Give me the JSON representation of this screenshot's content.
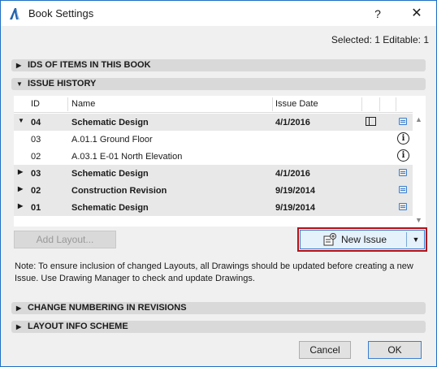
{
  "window": {
    "title": "Book Settings",
    "help_label": "?",
    "close_label": "✕",
    "border_color": "#1f6fc4"
  },
  "header": {
    "selection_info": "Selected: 1 Editable: 1"
  },
  "sections": {
    "ids": "IDS OF ITEMS IN THIS BOOK",
    "issue_history": "ISSUE HISTORY",
    "change_numbering": "CHANGE NUMBERING IN REVISIONS",
    "layout_info": "LAYOUT INFO SCHEME"
  },
  "table": {
    "columns": [
      "ID",
      "Name",
      "Issue Date"
    ],
    "rows": [
      {
        "id": "04",
        "name": "Schematic Design",
        "date": "4/1/2016",
        "group": true,
        "expanded": true,
        "icons": [
          "layout-icon",
          "doc-icon"
        ]
      },
      {
        "id": "03",
        "name": "A.01.1 Ground Floor",
        "date": "",
        "group": false,
        "icons": [
          "info-icon"
        ]
      },
      {
        "id": "02",
        "name": "A.03.1 E-01 North Elevation",
        "date": "",
        "group": false,
        "icons": [
          "info-icon"
        ]
      },
      {
        "id": "03",
        "name": "Schematic Design",
        "date": "4/1/2016",
        "group": true,
        "expanded": false,
        "icons": [
          "doc-icon"
        ]
      },
      {
        "id": "02",
        "name": "Construction Revision",
        "date": "9/19/2014",
        "group": true,
        "expanded": false,
        "icons": [
          "doc-icon"
        ]
      },
      {
        "id": "01",
        "name": "Schematic Design",
        "date": "9/19/2014",
        "group": true,
        "expanded": false,
        "icons": [
          "doc-icon"
        ]
      }
    ]
  },
  "buttons": {
    "add_layout": "Add Layout...",
    "new_issue": "New Issue",
    "cancel": "Cancel",
    "ok": "OK"
  },
  "note": "Note: To ensure inclusion of changed Layouts, all Drawings should be updated before creating a new Issue. Use Drawing Manager to check and update Drawings.",
  "colors": {
    "highlight": "#b3121a",
    "accent": "#3b7fd0"
  }
}
